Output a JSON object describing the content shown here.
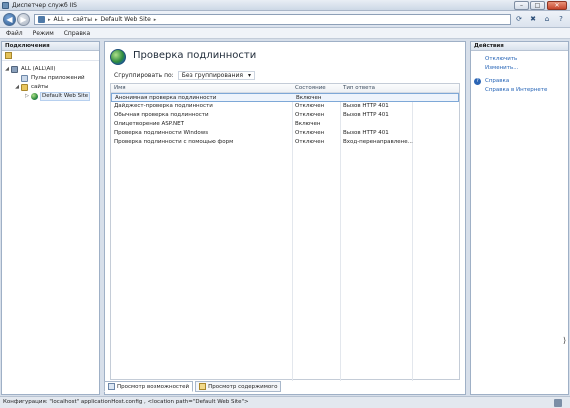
{
  "window": {
    "title": "Диспетчер служб IIS"
  },
  "address": {
    "segments": [
      "ALL",
      "сайты",
      "Default Web Site"
    ]
  },
  "menu": [
    "Файл",
    "Режим",
    "Справка"
  ],
  "connections": {
    "header": "Подключения",
    "tree": [
      {
        "label": "ALL (ALL\\All)",
        "level": 0,
        "expander": "◢",
        "icon": "server-icon"
      },
      {
        "label": "Пулы приложений",
        "level": 1,
        "expander": "",
        "icon": "app-pools-icon"
      },
      {
        "label": "сайты",
        "level": 1,
        "expander": "◢",
        "icon": "sites-folder-icon"
      },
      {
        "label": "Default Web Site",
        "level": 2,
        "expander": "▷",
        "icon": "globe-icon",
        "selected": true
      }
    ]
  },
  "main": {
    "title": "Проверка подлинности",
    "group_label": "Сгруппировать по:",
    "group_value": "Без группирования",
    "columns": [
      "Имя",
      "Состояние",
      "Тип ответа"
    ],
    "rows": [
      {
        "name": "Анонимная проверка подлинности",
        "state": "Включен",
        "response": ""
      },
      {
        "name": "Дайджест-проверка подлинности",
        "state": "Отключен",
        "response": "Вызов HTTP 401"
      },
      {
        "name": "Обычная проверка подлинности",
        "state": "Отключен",
        "response": "Вызов HTTP 401"
      },
      {
        "name": "Олицетворение ASP.NET",
        "state": "Включен",
        "response": ""
      },
      {
        "name": "Проверка подлинности Windows",
        "state": "Отключен",
        "response": "Вызов HTTP 401"
      },
      {
        "name": "Проверка подлинности с помощью форм",
        "state": "Отключен",
        "response": "Вход-перенаправлене..."
      }
    ]
  },
  "view_tabs": [
    "Просмотр возможностей",
    "Просмотр содержимого"
  ],
  "actions": {
    "header": "Действия",
    "items": [
      "Отключить",
      "Изменить..."
    ],
    "help": [
      "Справка",
      "Справка в Интернете"
    ]
  },
  "status": {
    "text": "Конфигурация: \"localhost\" applicationHost.config , <location path=\"Default Web Site\">"
  }
}
